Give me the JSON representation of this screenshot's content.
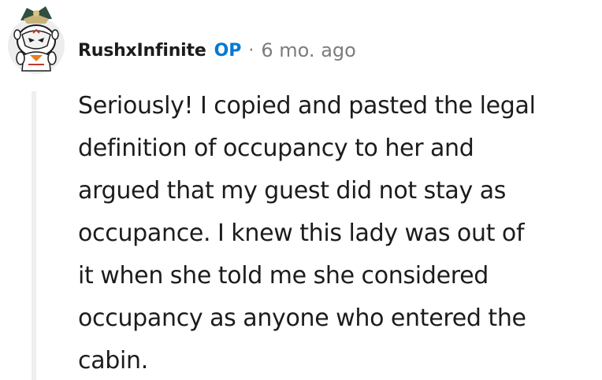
{
  "comment": {
    "author": "RushxInfinite",
    "op_badge": "OP",
    "separator": "·",
    "age": "6 mo. ago",
    "body_lines": [
      "Seriously! I copied and pasted the legal",
      "definition of occupancy to her and",
      "argued that my guest did not stay as",
      "occupance. I knew this lady was out of",
      "it when she told me she considered",
      "occupancy as anyone who entered the",
      "cabin."
    ]
  },
  "colors": {
    "op": "#0079d3",
    "text": "#1c1c1c",
    "meta": "#7c7c7c",
    "thread_line": "#edeff1"
  },
  "icons": {
    "avatar": "snoo-avatar-with-mask-icon"
  }
}
